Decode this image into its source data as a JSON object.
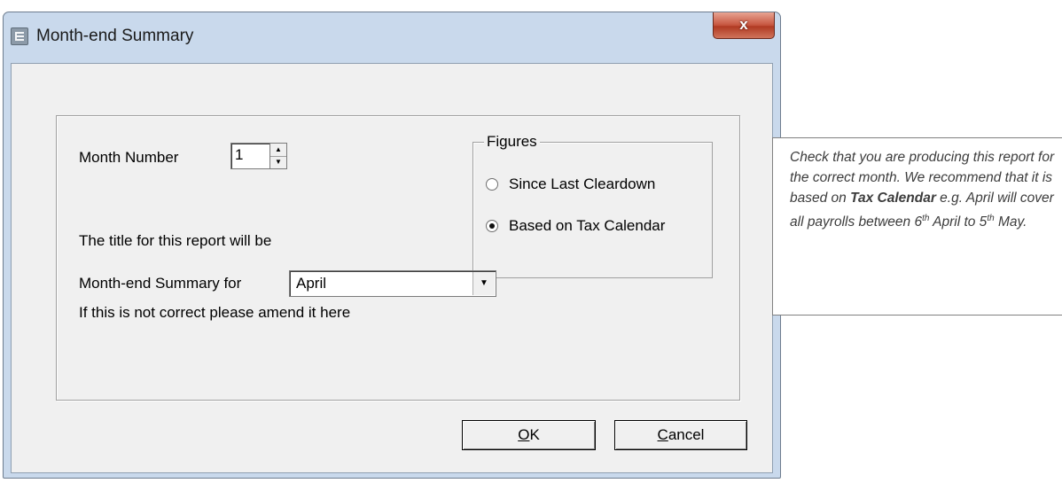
{
  "window": {
    "title": "Month-end Summary",
    "close_glyph": "x"
  },
  "form": {
    "month_number_label": "Month Number",
    "month_number_value": "1",
    "title_info": "The title for this report will be",
    "summary_for_label": "Month-end Summary for",
    "summary_for_value": "April",
    "amend_hint": "If this is not correct please amend it here"
  },
  "figures": {
    "legend": "Figures",
    "options": [
      {
        "label": "Since Last Cleardown",
        "selected": false
      },
      {
        "label": "Based on Tax Calendar",
        "selected": true
      }
    ]
  },
  "buttons": {
    "ok_accel": "O",
    "ok_rest": "K",
    "cancel_accel": "C",
    "cancel_rest": "ancel"
  },
  "callout": {
    "text_1": "Check that you are producing this report for the correct month.  We recommend that it is based on ",
    "bold": "Tax Calendar",
    "text_2": " e.g. April will cover all payrolls between 6",
    "sup_1": "th",
    "text_3": " April to 5",
    "sup_2": "th",
    "text_4": " May."
  },
  "icons": {
    "app": "app-icon",
    "close": "close-icon",
    "spin_up": "spin-up-icon",
    "spin_down": "spin-down-icon",
    "dropdown": "chevron-down-icon"
  },
  "colors": {
    "titlebar": "#c9d9ec",
    "client": "#f0f0f0",
    "close_button": "#c6553e",
    "callout_text": "#3c3c3c"
  }
}
